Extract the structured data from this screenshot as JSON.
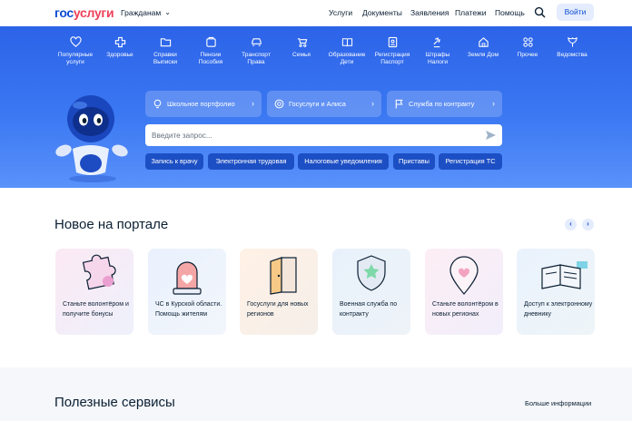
{
  "header": {
    "logo_part1": "гос",
    "logo_part2": "услуги",
    "persona": "Гражданам",
    "nav": [
      "Услуги",
      "Документы",
      "Заявления",
      "Платежи",
      "Помощь"
    ],
    "login": "Войти"
  },
  "categories": [
    {
      "label": "Популярные\nуслуги",
      "icon": "heart-icon"
    },
    {
      "label": "Здоровье",
      "icon": "medical-cross-icon"
    },
    {
      "label": "Справки\nВыписки",
      "icon": "folder-icon"
    },
    {
      "label": "Пенсии\nПособия",
      "icon": "wallet-icon"
    },
    {
      "label": "Транспорт\nПрава",
      "icon": "car-icon"
    },
    {
      "label": "Семья",
      "icon": "stroller-icon"
    },
    {
      "label": "Образование\nДети",
      "icon": "book-icon"
    },
    {
      "label": "Регистрация\nПаспорт",
      "icon": "passport-icon"
    },
    {
      "label": "Штрафы\nНалоги",
      "icon": "gavel-icon"
    },
    {
      "label": "Земля Дом",
      "icon": "house-icon"
    },
    {
      "label": "Прочее",
      "icon": "grid-icon"
    },
    {
      "label": "Ведомства",
      "icon": "emblem-icon"
    }
  ],
  "quick": [
    {
      "label": "Школьное портфолио",
      "icon": "lightbulb-icon"
    },
    {
      "label": "Госуслуги и Алиса",
      "icon": "alice-icon"
    },
    {
      "label": "Служба по контракту",
      "icon": "flag-icon"
    }
  ],
  "search": {
    "placeholder": "Введите запрос..."
  },
  "chips": [
    "Запись к врачу",
    "Электронная трудовая",
    "Налоговые уведомления",
    "Приставы",
    "Регистрация ТС"
  ],
  "new_section": {
    "title": "Новое на портале",
    "cards": [
      "Станьте волонтёром и получите бонусы",
      "ЧС в Курской области. Помощь жителям",
      "Госуслуги для новых регионов",
      "Военная служба по контракту",
      "Станьте волонтёром в новых регионах",
      "Доступ к электронному дневнику"
    ]
  },
  "useful": {
    "title": "Полезные сервисы",
    "more": "Больше информации"
  },
  "colors": {
    "brand_blue": "#0d4cd3",
    "brand_red": "#ee3f58",
    "hero": "#3b78f2",
    "chip": "#1d4fc4"
  }
}
